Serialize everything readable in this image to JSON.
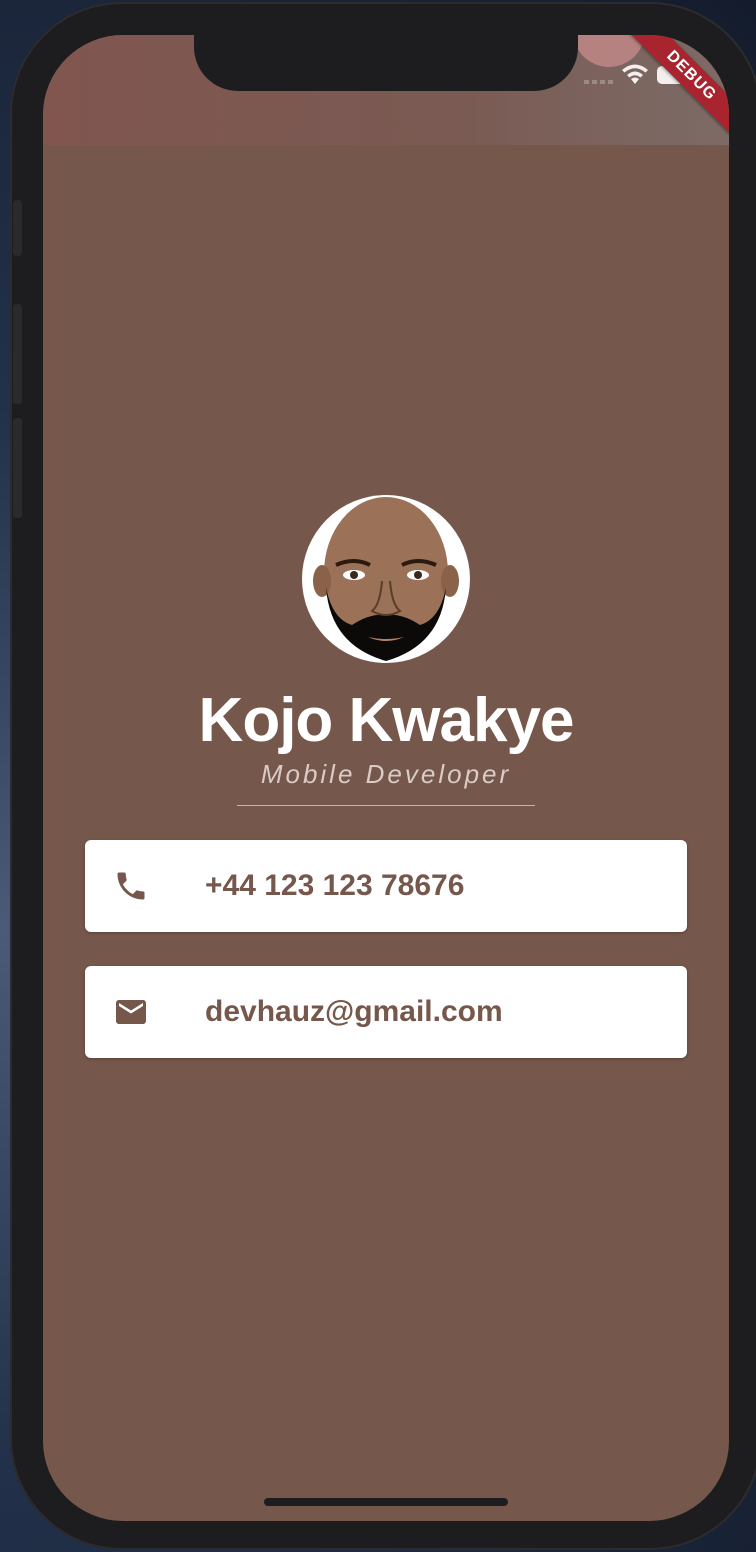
{
  "status_bar": {
    "debug_label": "DEBUG"
  },
  "profile": {
    "name": "Kojo Kwakye",
    "title": "Mobile Developer"
  },
  "contacts": [
    {
      "icon": "phone-icon",
      "value": "+44 123 123 78676"
    },
    {
      "icon": "mail-icon",
      "value": "devhauz@gmail.com"
    }
  ],
  "colors": {
    "background": "#76574b",
    "card": "#ffffff",
    "card_text": "#76574b",
    "debug_banner": "#a8242e"
  }
}
